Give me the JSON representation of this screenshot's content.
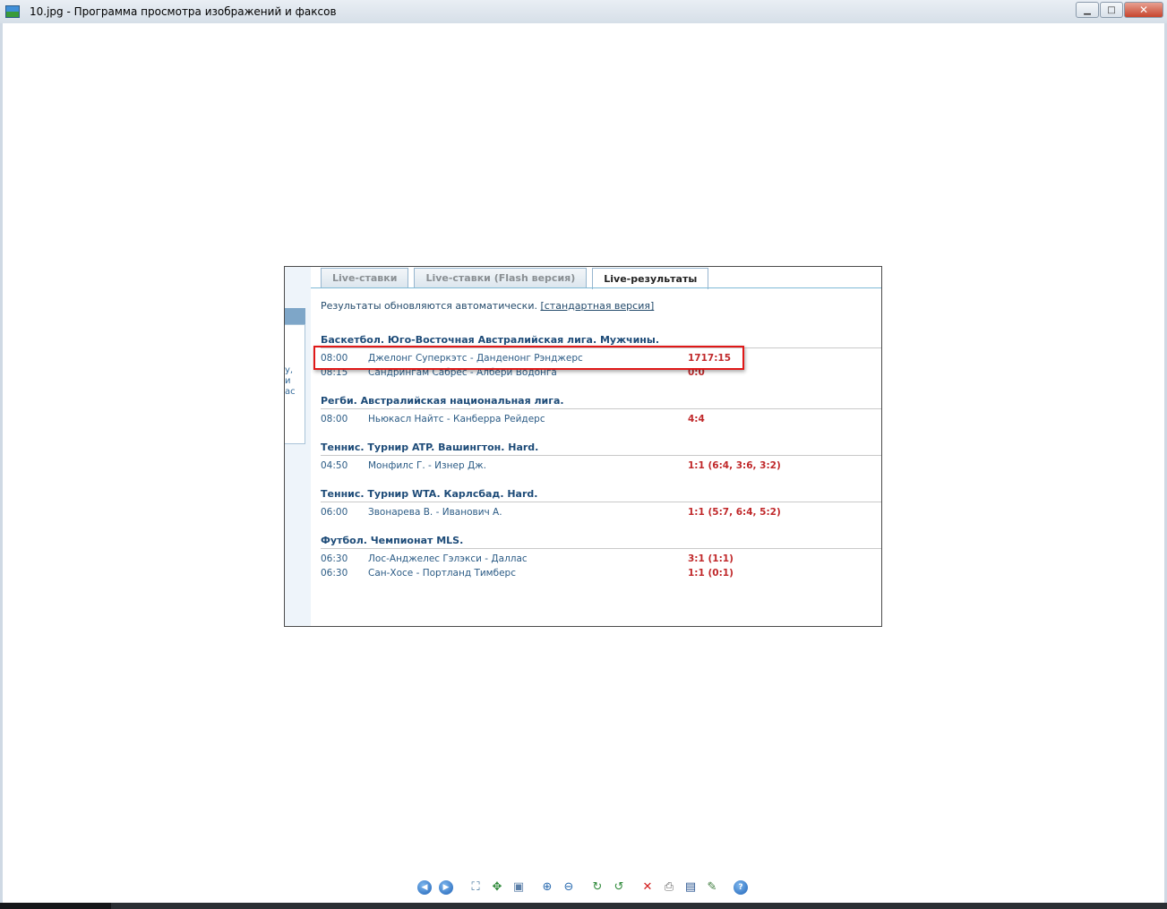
{
  "window": {
    "title": "10.jpg - Программа просмотра изображений и факсов",
    "min_symbol": "▁",
    "max_symbol": "□",
    "close_symbol": "✕"
  },
  "image": {
    "tabs": [
      {
        "label": "Live-ставки",
        "active": false
      },
      {
        "label": "Live-ставки (Flash версия)",
        "active": false
      },
      {
        "label": "Live-результаты",
        "active": true
      }
    ],
    "note_text": "Результаты обновляются автоматически.",
    "note_link": "[стандартная версия]",
    "left_fragments": [
      "у,",
      "и",
      "ас"
    ],
    "leagues": [
      {
        "name": "Баскетбол. Юго-Восточная Австралийская лига. Мужчины.",
        "matches": [
          {
            "time": "08:00",
            "teams": "Джелонг Суперкэтс - Данденонг Рэнджерс",
            "score": "1717:15"
          },
          {
            "time": "08:15",
            "teams": "Сандрингам Сабрес - Албери Водонга",
            "score": "0:0"
          }
        ]
      },
      {
        "name": "Регби. Австралийская национальная лига.",
        "matches": [
          {
            "time": "08:00",
            "teams": "Ньюкасл Найтс - Канберра Рейдерс",
            "score": "4:4"
          }
        ]
      },
      {
        "name": "Теннис. Турнир ATP. Вашингтон. Hard.",
        "matches": [
          {
            "time": "04:50",
            "teams": "Монфилс Г. - Изнер Дж.",
            "score": "1:1 (6:4, 3:6, 3:2)"
          }
        ]
      },
      {
        "name": "Теннис. Турнир WTA. Карлсбад. Hard.",
        "matches": [
          {
            "time": "06:00",
            "teams": "Звонарева В. - Иванович А.",
            "score": "1:1 (5:7, 6:4, 5:2)"
          }
        ]
      },
      {
        "name": "Футбол. Чемпионат MLS.",
        "matches": [
          {
            "time": "06:30",
            "teams": "Лос-Анджелес Гэлэкси - Даллас",
            "score": "3:1 (1:1)"
          },
          {
            "time": "06:30",
            "teams": "Сан-Хосе - Портланд Тимберс",
            "score": "1:1 (0:1)"
          }
        ]
      }
    ]
  },
  "toolbar": {
    "buttons": [
      {
        "name": "previous-image-icon",
        "glyph": "◀"
      },
      {
        "name": "next-image-icon",
        "glyph": "▶"
      },
      {
        "name": "best-fit-icon",
        "glyph": "⛶"
      },
      {
        "name": "actual-size-icon",
        "glyph": "✥"
      },
      {
        "name": "slideshow-icon",
        "glyph": "▣"
      },
      {
        "name": "zoom-in-icon",
        "glyph": "⊕"
      },
      {
        "name": "zoom-out-icon",
        "glyph": "⊖"
      },
      {
        "name": "rotate-clockwise-icon",
        "glyph": "↻"
      },
      {
        "name": "rotate-counterclockwise-icon",
        "glyph": "↺"
      },
      {
        "name": "delete-icon",
        "glyph": "✕"
      },
      {
        "name": "print-icon",
        "glyph": "⎙"
      },
      {
        "name": "save-icon",
        "glyph": "▤"
      },
      {
        "name": "edit-image-icon",
        "glyph": "✎"
      },
      {
        "name": "help-icon",
        "glyph": "?"
      }
    ]
  },
  "colors": {
    "league_text": "#1d4b78",
    "match_text": "#2b5b85",
    "score_text": "#c0282a",
    "highlight": "#e01818"
  }
}
